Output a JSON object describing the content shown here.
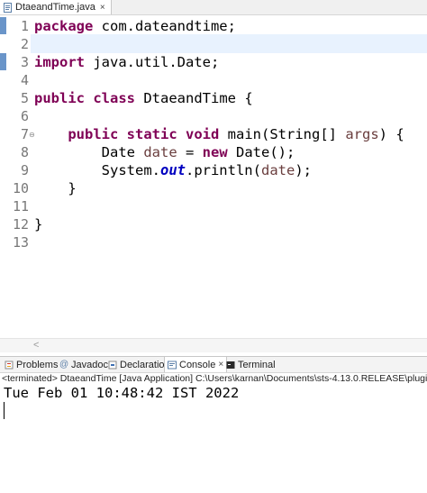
{
  "editor": {
    "tab_label": "DtaeandTime.java",
    "tab_close": "×",
    "line_numbers": [
      "1",
      "2",
      "3",
      "4",
      "5",
      "6",
      "7",
      "8",
      "9",
      "10",
      "11",
      "12",
      "13"
    ],
    "fold_marker": "⊖",
    "code": {
      "l1_kw": "package",
      "l1_rest": " com.dateandtime;",
      "l3_kw": "import",
      "l3_rest": " java.util.Date;",
      "l5_kw1": "public",
      "l5_kw2": "class",
      "l5_rest": " DtaeandTime {",
      "l7_kw1": "public",
      "l7_kw2": "static",
      "l7_kw3": "void",
      "l7_rest1": " main(String[] ",
      "l7_var": "args",
      "l7_rest2": ") {",
      "l8_type": "Date ",
      "l8_var": "date",
      "l8_eq": " = ",
      "l8_kw": "new",
      "l8_rest": " Date();",
      "l9_sys": "System.",
      "l9_field": "out",
      "l9_call": ".println(",
      "l9_var": "date",
      "l9_end": ");",
      "l10": "}",
      "l12": "}"
    },
    "scroll_left": "<"
  },
  "console": {
    "tabs": [
      {
        "label": "Problems"
      },
      {
        "label": "Javadoc"
      },
      {
        "label": "Declaration"
      },
      {
        "label": "Console",
        "close": "×"
      },
      {
        "label": "Terminal"
      }
    ],
    "terminated": "<terminated> DtaeandTime [Java Application] C:\\Users\\karnan\\Documents\\sts-4.13.0.RELEASE\\plugins\\org.ecli",
    "output": "Tue Feb 01 10:48:42 IST 2022"
  },
  "colors": {
    "keyword": "#7f0055",
    "local_variable": "#6a3e3e",
    "static_field": "#0000c0",
    "current_line": "#e8f2fe",
    "marker": "#6a95c9"
  }
}
